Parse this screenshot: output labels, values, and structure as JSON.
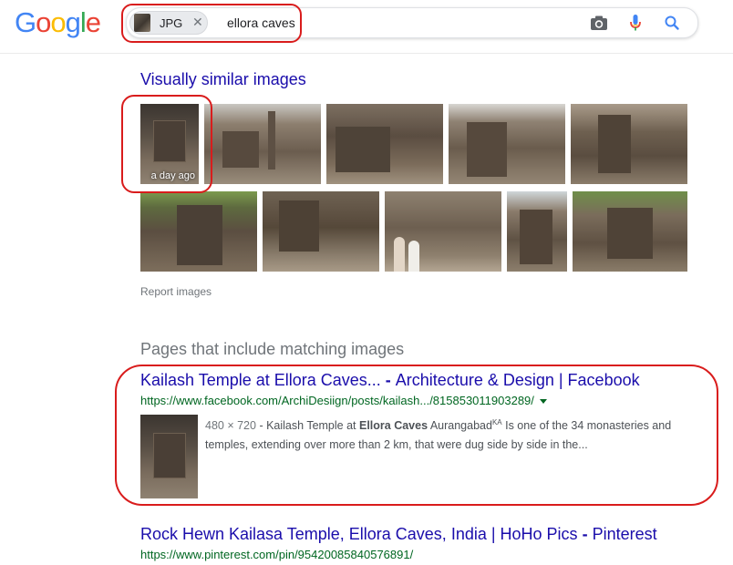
{
  "header": {
    "logo_letters": [
      {
        "char": "G",
        "color": "#4285F4"
      },
      {
        "char": "o",
        "color": "#EA4335"
      },
      {
        "char": "o",
        "color": "#FBBC05"
      },
      {
        "char": "g",
        "color": "#4285F4"
      },
      {
        "char": "l",
        "color": "#34A853"
      },
      {
        "char": "e",
        "color": "#EA4335"
      }
    ],
    "search": {
      "chip_label": "JPG",
      "chip_close": "✕",
      "query": "ellora caves",
      "icons": [
        "camera-icon",
        "microphone-icon",
        "search-icon"
      ]
    }
  },
  "similar": {
    "heading": "Visually similar images",
    "age_label": "a day ago",
    "report_label": "Report images"
  },
  "matching": {
    "heading": "Pages that include matching images",
    "results": [
      {
        "title_main": "Kailash Temple at Ellora Caves...",
        "title_sep": " - ",
        "title_site": "Architecture & Design | Facebook",
        "url": "https://www.facebook.com/ArchiDesiign/posts/kailash.../815853011903289/",
        "dims": "480 × 720",
        "snippet_sep": " - Kailash Temple at ",
        "snippet_bold": "Ellora Caves",
        "snippet_a": " Aurangabad",
        "snippet_sup": "KA",
        "snippet_b": " Is one of the 34 monasteries and temples, extending over more than 2 km, that were dug side by side in the..."
      },
      {
        "title_main": "Rock Hewn Kailasa Temple, Ellora Caves, India | HoHo Pics",
        "title_sep": " - ",
        "title_site": "Pinterest",
        "url": "https://www.pinterest.com/pin/95420085840576891/"
      }
    ]
  },
  "colors": {
    "link": "#1a0dab",
    "url": "#006621",
    "annotation": "#d91c1c",
    "muted": "#70757a"
  }
}
